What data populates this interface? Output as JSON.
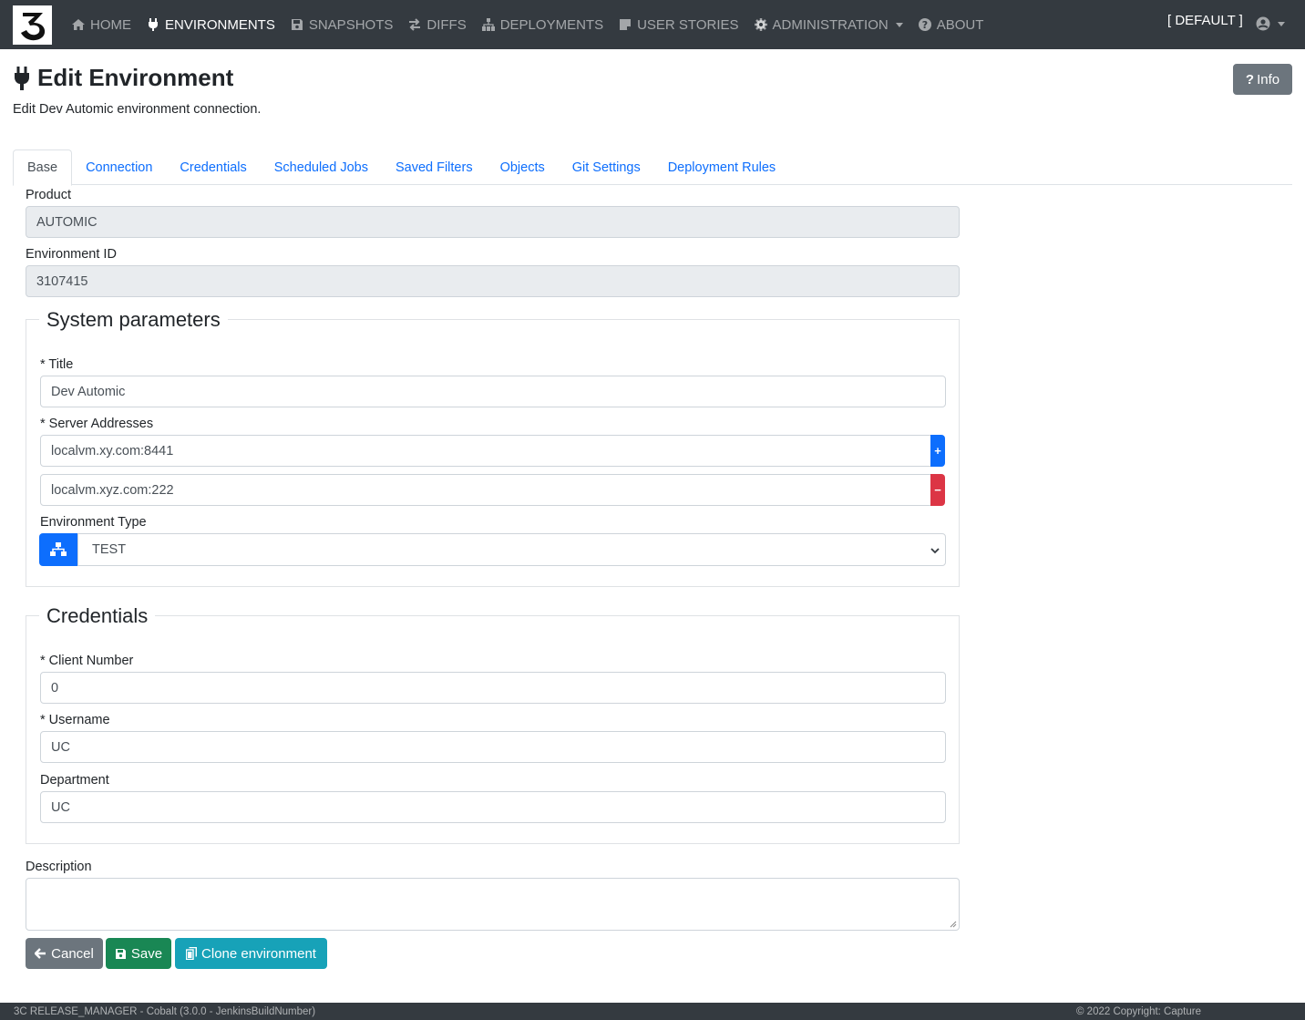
{
  "nav": {
    "items": [
      {
        "label": "HOME",
        "icon": "home-icon"
      },
      {
        "label": "ENVIRONMENTS",
        "icon": "plug-icon"
      },
      {
        "label": "SNAPSHOTS",
        "icon": "save-icon"
      },
      {
        "label": "DIFFS",
        "icon": "diff-icon"
      },
      {
        "label": "DEPLOYMENTS",
        "icon": "sitemap-icon"
      },
      {
        "label": "USER STORIES",
        "icon": "sticky-note-icon"
      },
      {
        "label": "ADMINISTRATION",
        "icon": "gear-icon"
      },
      {
        "label": "ABOUT",
        "icon": "question-circle-icon"
      }
    ],
    "profile": "[ DEFAULT ]"
  },
  "header": {
    "title": "Edit Environment",
    "subtitle": "Edit Dev Automic environment connection.",
    "info_label": "Info"
  },
  "tabs": [
    "Base",
    "Connection",
    "Credentials",
    "Scheduled Jobs",
    "Saved Filters",
    "Objects",
    "Git Settings",
    "Deployment Rules"
  ],
  "form": {
    "product_label": "Product",
    "product_value": "AUTOMIC",
    "env_id_label": "Environment ID",
    "env_id_value": "3107415",
    "system_legend": "System parameters",
    "title_label": "* Title",
    "title_value": "Dev Automic",
    "server_label": "* Server Addresses",
    "servers": [
      "localvm.xy.com:8441",
      "localvm.xyz.com:222"
    ],
    "add_symbol": "+",
    "remove_symbol": "−",
    "env_type_label": "Environment Type",
    "env_type_value": "TEST",
    "credentials_legend": "Credentials",
    "client_label": "* Client Number",
    "client_value": "0",
    "username_label": "* Username",
    "username_value": "UC",
    "department_label": "Department",
    "department_value": "UC",
    "description_label": "Description"
  },
  "buttons": {
    "cancel": "Cancel",
    "save": "Save",
    "clone": "Clone environment"
  },
  "footer": {
    "left": "3C RELEASE_MANAGER - Cobalt (3.0.0 - JenkinsBuildNumber)",
    "right": "© 2022 Copyright: Capture"
  },
  "colors": {
    "navbar": "#343a40",
    "primary": "#0d6efd",
    "danger": "#dc3545",
    "success": "#198754",
    "info": "#17a2b8",
    "secondary": "#6c757d"
  }
}
